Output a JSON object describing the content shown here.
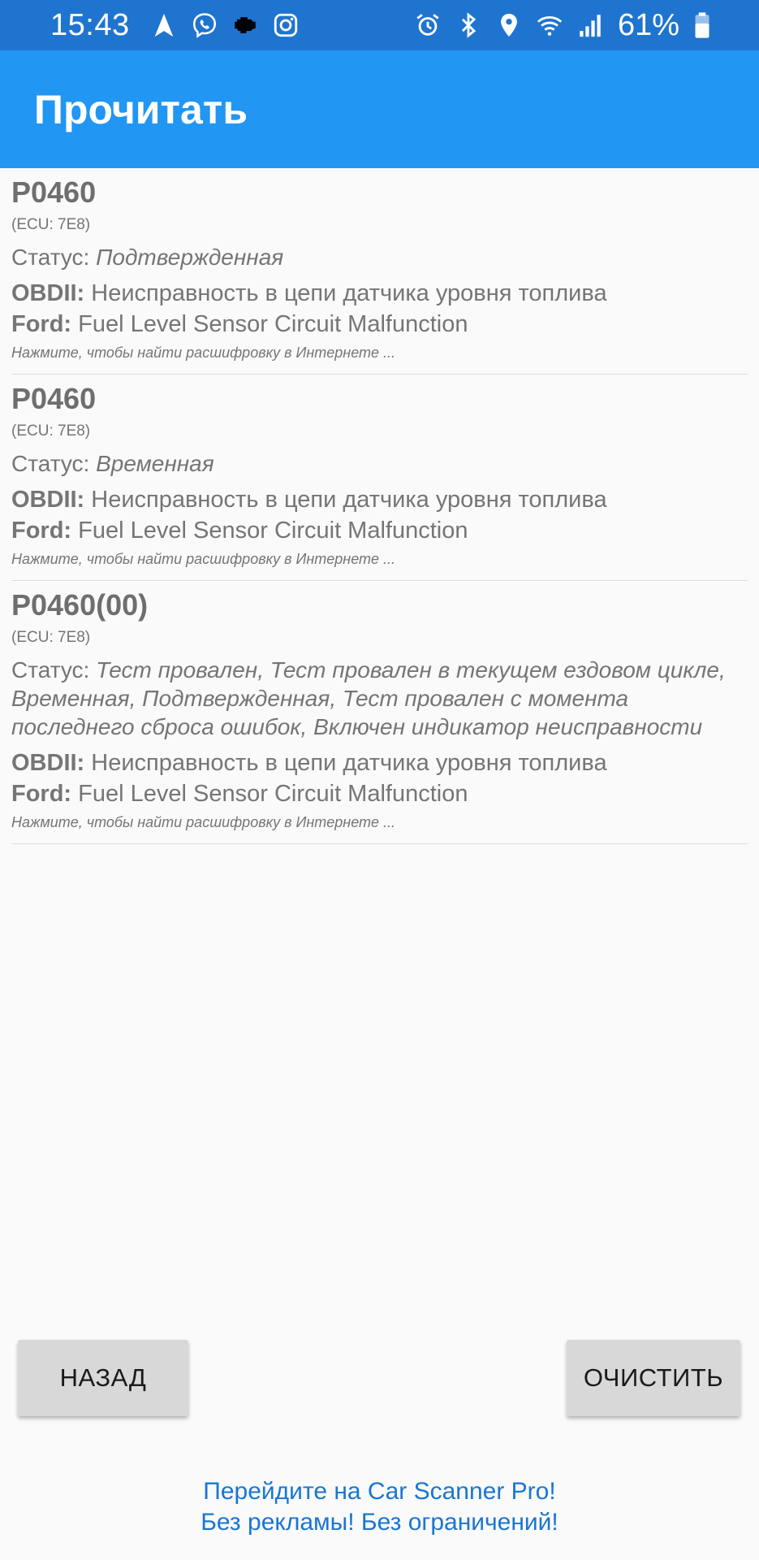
{
  "status_bar": {
    "time": "15:43",
    "left_icons": [
      "navigation-icon",
      "viber-icon",
      "check-engine-icon",
      "instagram-icon"
    ],
    "right_icons": [
      "alarm-icon",
      "bluetooth-icon",
      "location-icon",
      "wifi-icon",
      "signal-icon"
    ],
    "battery": "61%"
  },
  "app_bar": {
    "title": "Прочитать"
  },
  "dtc": [
    {
      "code": "P0460",
      "ecu": "(ECU: 7E8)",
      "status_label": "Статус:",
      "status_value": "Подтвержденная",
      "obd_label": "OBDII:",
      "obd_text": "Неисправность в цепи датчика уровня топлива",
      "make_label": "Ford:",
      "make_text": "Fuel Level Sensor Circuit Malfunction",
      "hint": "Нажмите, чтобы найти расшифровку в Интернете ..."
    },
    {
      "code": "P0460",
      "ecu": "(ECU: 7E8)",
      "status_label": "Статус:",
      "status_value": "Временная",
      "obd_label": "OBDII:",
      "obd_text": "Неисправность в цепи датчика уровня топлива",
      "make_label": "Ford:",
      "make_text": "Fuel Level Sensor Circuit Malfunction",
      "hint": "Нажмите, чтобы найти расшифровку в Интернете ..."
    },
    {
      "code": "P0460(00)",
      "ecu": "(ECU: 7E8)",
      "status_label": "Статус:",
      "status_value": "Тест провален, Тест провален в текущем ездовом цикле, Временная, Подтвержденная, Тест провален с момента последнего сброса ошибок, Включен индикатор неисправности",
      "obd_label": "OBDII:",
      "obd_text": "Неисправность в цепи датчика уровня топлива",
      "make_label": "Ford:",
      "make_text": "Fuel Level Sensor Circuit Malfunction",
      "hint": "Нажмите, чтобы найти расшифровку в Интернете ..."
    }
  ],
  "buttons": {
    "back": "НАЗАД",
    "clear": "ОЧИСТИТЬ"
  },
  "promo": {
    "line1": "Перейдите на Car Scanner Pro!",
    "line2": "Без рекламы! Без ограничений!"
  },
  "colors": {
    "status_bar": "#1f74cf",
    "app_bar": "#2196f3",
    "promo_link": "#1976d2"
  }
}
